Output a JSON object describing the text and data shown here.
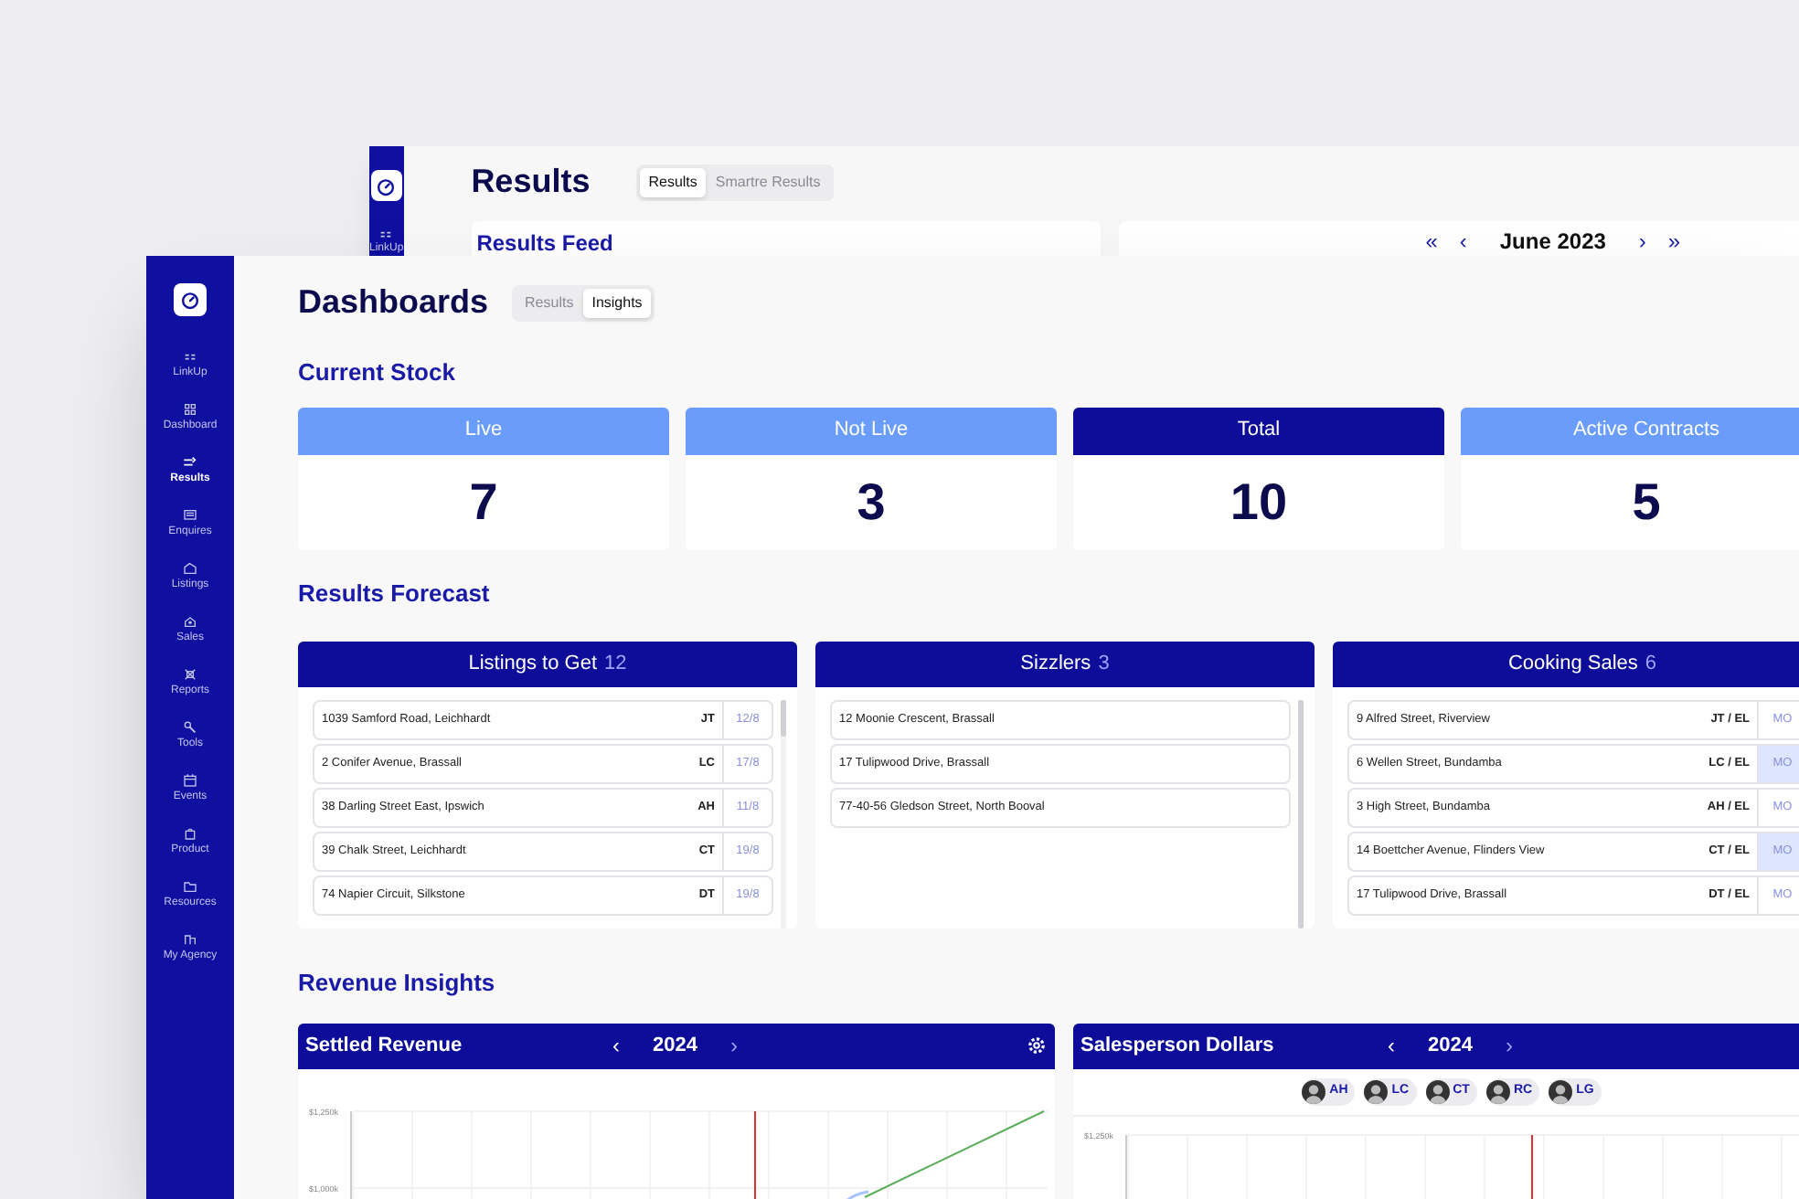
{
  "back_window": {
    "title": "Results",
    "sidebar_items": [
      {
        "label": "LinkUp"
      }
    ],
    "tabs": [
      {
        "label": "Results",
        "selected": true
      },
      {
        "label": "Smartre Results",
        "selected": false
      }
    ],
    "feed_title": "Results Feed",
    "calendar": {
      "first": "«",
      "prev": "‹",
      "month": "June 2023",
      "next": "›",
      "last": "»"
    }
  },
  "window": {
    "title": "Dashboards",
    "tabs": [
      {
        "label": "Results",
        "selected": false
      },
      {
        "label": "Insights",
        "selected": true
      }
    ],
    "sidebar": {
      "items": [
        {
          "label": "LinkUp",
          "selected": false
        },
        {
          "label": "Dashboard",
          "selected": false
        },
        {
          "label": "Results",
          "selected": true
        },
        {
          "label": "Enquires",
          "selected": false
        },
        {
          "label": "Listings",
          "selected": false
        },
        {
          "label": "Sales",
          "selected": false
        },
        {
          "label": "Reports",
          "selected": false
        },
        {
          "label": "Tools",
          "selected": false
        },
        {
          "label": "Events",
          "selected": false
        },
        {
          "label": "Product",
          "selected": false
        },
        {
          "label": "Resources",
          "selected": false
        },
        {
          "label": "My Agency",
          "selected": false
        }
      ]
    },
    "current_stock": {
      "title": "Current Stock",
      "cards": [
        {
          "label": "Live",
          "value": "7",
          "highlighted": false
        },
        {
          "label": "Not Live",
          "value": "3",
          "highlighted": false
        },
        {
          "label": "Total",
          "value": "10",
          "highlighted": true
        },
        {
          "label": "Active Contracts",
          "value": "5",
          "highlighted": false
        }
      ]
    },
    "results_forecast": {
      "title": "Results Forecast",
      "columns": [
        {
          "title": "Listings to Get",
          "count": "12",
          "kind": "dated",
          "rows": [
            {
              "address": "1039 Samford Road, Leichhardt",
              "agent": "JT",
              "date": "12/8"
            },
            {
              "address": "2 Conifer Avenue, Brassall",
              "agent": "LC",
              "date": "17/8"
            },
            {
              "address": "38 Darling Street East, Ipswich",
              "agent": "AH",
              "date": "11/8"
            },
            {
              "address": "39 Chalk Street, Leichhardt",
              "agent": "CT",
              "date": "19/8"
            },
            {
              "address": "74 Napier Circuit, Silkstone",
              "agent": "DT",
              "date": "19/8"
            }
          ]
        },
        {
          "title": "Sizzlers",
          "count": "3",
          "kind": "plain",
          "rows": [
            {
              "address": "12 Moonie Crescent, Brassall"
            },
            {
              "address": "17 Tulipwood Drive, Brassall"
            },
            {
              "address": "77-40-56 Gledson Street, North Booval"
            }
          ]
        },
        {
          "title": "Cooking Sales",
          "count": "6",
          "kind": "dated",
          "rows": [
            {
              "address": "9 Alfred Street, Riverview",
              "agent": "JT / EL",
              "date": "MO",
              "highlighted": false
            },
            {
              "address": "6 Wellen Street, Bundamba",
              "agent": "LC / EL",
              "date": "MO",
              "highlighted": true
            },
            {
              "address": "3 High Street, Bundamba",
              "agent": "AH / EL",
              "date": "MO",
              "highlighted": false
            },
            {
              "address": "14 Boettcher Avenue, Flinders View",
              "agent": "CT / EL",
              "date": "MO",
              "highlighted": true
            },
            {
              "address": "17 Tulipwood Drive, Brassall",
              "agent": "DT / EL",
              "date": "MO",
              "highlighted": false
            }
          ]
        }
      ]
    },
    "revenue_insights": {
      "title": "Revenue Insights",
      "panels": [
        {
          "title": "Settled Revenue",
          "prev": "‹",
          "year": "2024",
          "next": "›",
          "settings": true,
          "y_labels": [
            "$1,250k",
            "$1,000k"
          ]
        },
        {
          "title": "Salesperson Dollars",
          "prev": "‹",
          "year": "2024",
          "next": "›",
          "settings": false,
          "y_labels": [
            "$1,250k"
          ],
          "people": [
            {
              "initials": "AH"
            },
            {
              "initials": "LC"
            },
            {
              "initials": "CT"
            },
            {
              "initials": "RC"
            },
            {
              "initials": "LG"
            }
          ]
        }
      ]
    }
  }
}
